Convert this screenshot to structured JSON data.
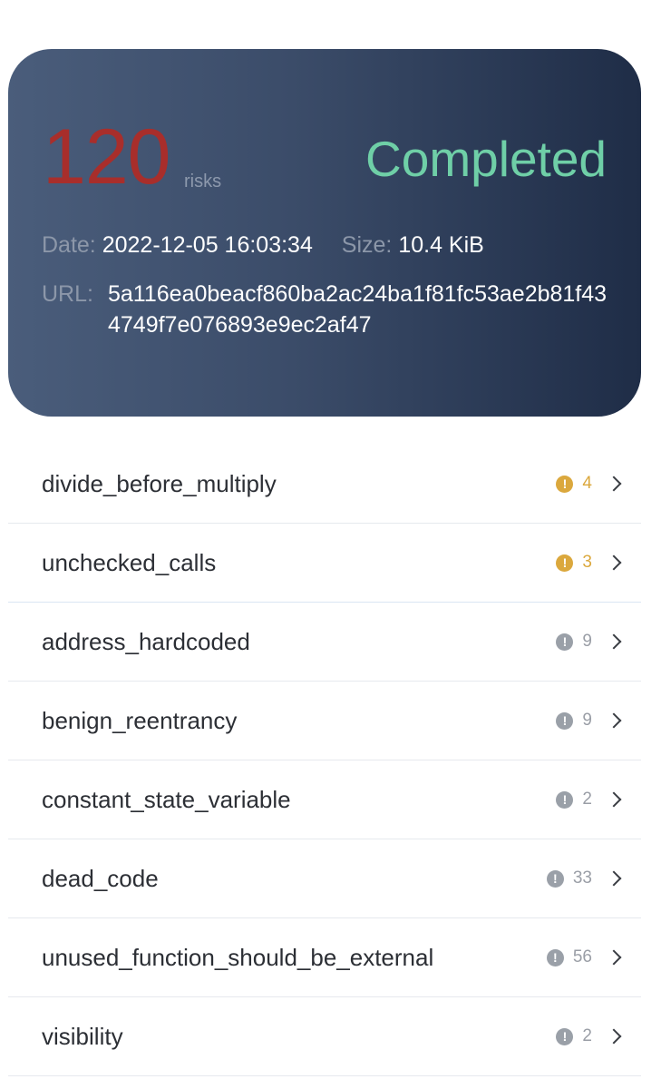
{
  "summary": {
    "risk_count": "120",
    "risk_unit": "risks",
    "status": "Completed",
    "date_label": "Date:",
    "date_value": "2022-12-05 16:03:34",
    "size_label": "Size:",
    "size_value": "10.4 KiB",
    "url_label": "URL:",
    "url_value": "5a116ea0beacf860ba2ac24ba1f81fc53ae2b81f434749f7e076893e9ec2af47",
    "colors": {
      "risk_count": "#a82e2b",
      "status": "#6fcfa7",
      "card_start": "#4a5d7b",
      "card_end": "#1f2d47"
    }
  },
  "findings": [
    {
      "name": "divide_before_multiply",
      "count": "4",
      "severity_color": "#dba83d",
      "icon": "exclamation-circle-icon"
    },
    {
      "name": "unchecked_calls",
      "count": "3",
      "severity_color": "#dba83d",
      "icon": "exclamation-circle-icon"
    },
    {
      "name": "address_hardcoded",
      "count": "9",
      "severity_color": "#9aa0a8",
      "icon": "exclamation-circle-icon"
    },
    {
      "name": "benign_reentrancy",
      "count": "9",
      "severity_color": "#9aa0a8",
      "icon": "exclamation-circle-icon"
    },
    {
      "name": "constant_state_variable",
      "count": "2",
      "severity_color": "#9aa0a8",
      "icon": "exclamation-circle-icon"
    },
    {
      "name": "dead_code",
      "count": "33",
      "severity_color": "#9aa0a8",
      "icon": "exclamation-circle-icon"
    },
    {
      "name": "unused_function_should_be_external",
      "count": "56",
      "severity_color": "#9aa0a8",
      "icon": "exclamation-circle-icon"
    },
    {
      "name": "visibility",
      "count": "2",
      "severity_color": "#9aa0a8",
      "icon": "exclamation-circle-icon"
    }
  ]
}
